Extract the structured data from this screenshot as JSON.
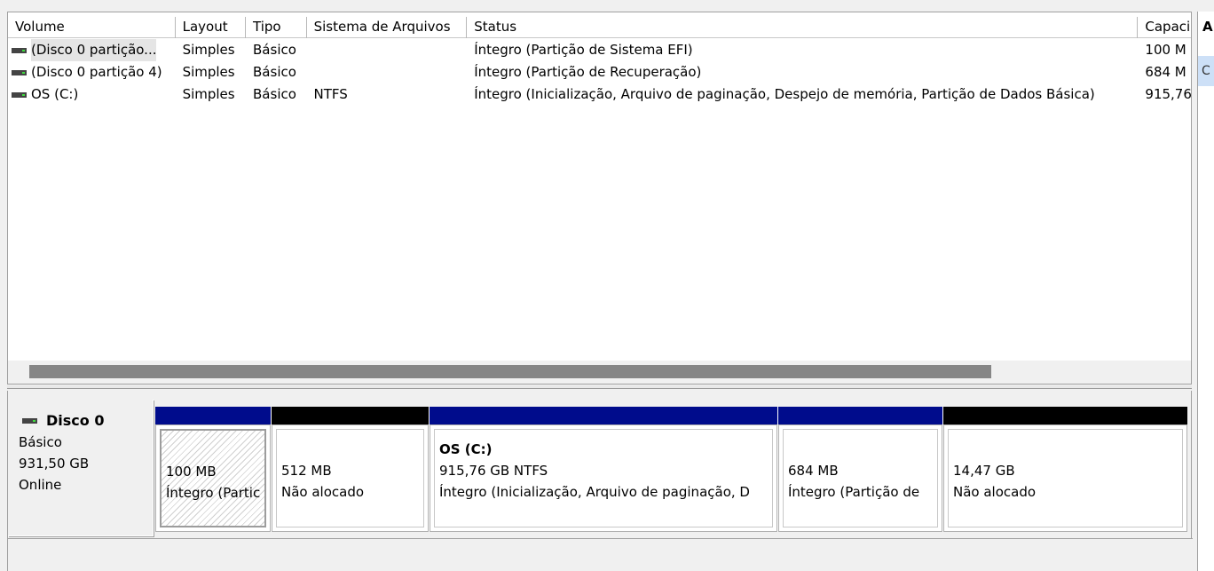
{
  "volume_list": {
    "columns": [
      "Volume",
      "Layout",
      "Tipo",
      "Sistema de Arquivos",
      "Status",
      "Capaci"
    ],
    "rows": [
      {
        "volume": "(Disco 0 partição...",
        "layout": "Simples",
        "tipo": "Básico",
        "fs": "",
        "status": "Íntegro (Partição de Sistema EFI)",
        "capacity": "100 M",
        "icon": "drive-icon"
      },
      {
        "volume": "(Disco 0 partição 4)",
        "layout": "Simples",
        "tipo": "Básico",
        "fs": "",
        "status": "Íntegro (Partição de Recuperação)",
        "capacity": "684 M",
        "icon": "drive-icon"
      },
      {
        "volume": "OS (C:)",
        "layout": "Simples",
        "tipo": "Básico",
        "fs": "NTFS",
        "status": "Íntegro (Inicialização, Arquivo de paginação, Despejo de memória, Partição de Dados Básica)",
        "capacity": "915,76",
        "icon": "drive-icon"
      }
    ]
  },
  "actions_pane": {
    "title": "A",
    "item": "C"
  },
  "disk": {
    "name": "Disco 0",
    "type": "Básico",
    "size": "931,50 GB",
    "state": "Online",
    "partitions": [
      {
        "name": "",
        "size": "100 MB",
        "status": "Íntegro (Partic",
        "bar": "blue"
      },
      {
        "name": "",
        "size": "512 MB",
        "status": "Não alocado",
        "bar": "black"
      },
      {
        "name": "OS  (C:)",
        "size": "915,76 GB NTFS",
        "status": "Íntegro (Inicialização, Arquivo de paginação, D",
        "bar": "blue"
      },
      {
        "name": "",
        "size": "684 MB",
        "status": "Íntegro (Partição de",
        "bar": "blue"
      },
      {
        "name": "",
        "size": "14,47 GB",
        "status": "Não alocado",
        "bar": "black"
      }
    ]
  },
  "colors": {
    "primary_partition_bar": "#000c8c",
    "unallocated_bar": "#000000",
    "selection_highlight": "#cde0f7"
  }
}
